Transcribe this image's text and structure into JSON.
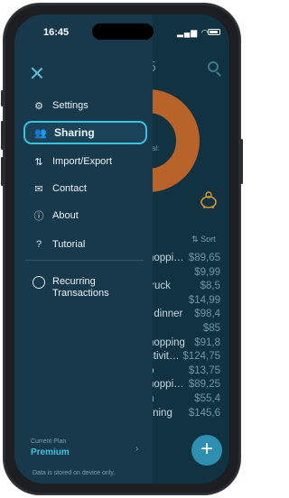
{
  "status_bar": {
    "time": "16:45"
  },
  "background": {
    "year_fragment": "5",
    "center_label_fragment": "al:",
    "sort_label": "Sort",
    "transactions": [
      {
        "name": "hoppi…",
        "amount": "$89,65"
      },
      {
        "name": "",
        "amount": "$9,99"
      },
      {
        "name": "truck",
        "amount": "$8,5"
      },
      {
        "name": "",
        "amount": "$14,99"
      },
      {
        "name": "t dinner",
        "amount": "$98,4"
      },
      {
        "name": "",
        "amount": "$85"
      },
      {
        "name": "hopping",
        "amount": "$91,8"
      },
      {
        "name": "ctivit…",
        "amount": "$124,75"
      },
      {
        "name": "p",
        "amount": "$13,75"
      },
      {
        "name": "hoppi…",
        "amount": "$89,25"
      },
      {
        "name": "n",
        "amount": "$55,4"
      },
      {
        "name": "lining",
        "amount": "$145,6"
      }
    ],
    "fab_label": "+",
    "donut_colors": {
      "orange": "#b8632a",
      "teal": "#1f9bb8",
      "center": "#0e2c38"
    }
  },
  "drawer": {
    "menu": [
      {
        "label": "Settings",
        "icon": "gear-icon",
        "glyph": "⚙"
      },
      {
        "label": "Sharing",
        "icon": "people-icon",
        "glyph": "👥"
      },
      {
        "label": "Import/Export",
        "icon": "import-export-icon",
        "glyph": "⇅"
      },
      {
        "label": "Contact",
        "icon": "envelope-icon",
        "glyph": "✉"
      },
      {
        "label": "About",
        "icon": "info-icon",
        "glyph": "ⓘ"
      },
      {
        "label": "Tutorial",
        "icon": "help-icon",
        "glyph": "?"
      }
    ],
    "recurring_label": "Recurring Transactions",
    "plan_label": "Current Plan",
    "plan_value": "Premium",
    "footnote": "Data is stored on device only.",
    "accent_color": "#39c2e2"
  }
}
